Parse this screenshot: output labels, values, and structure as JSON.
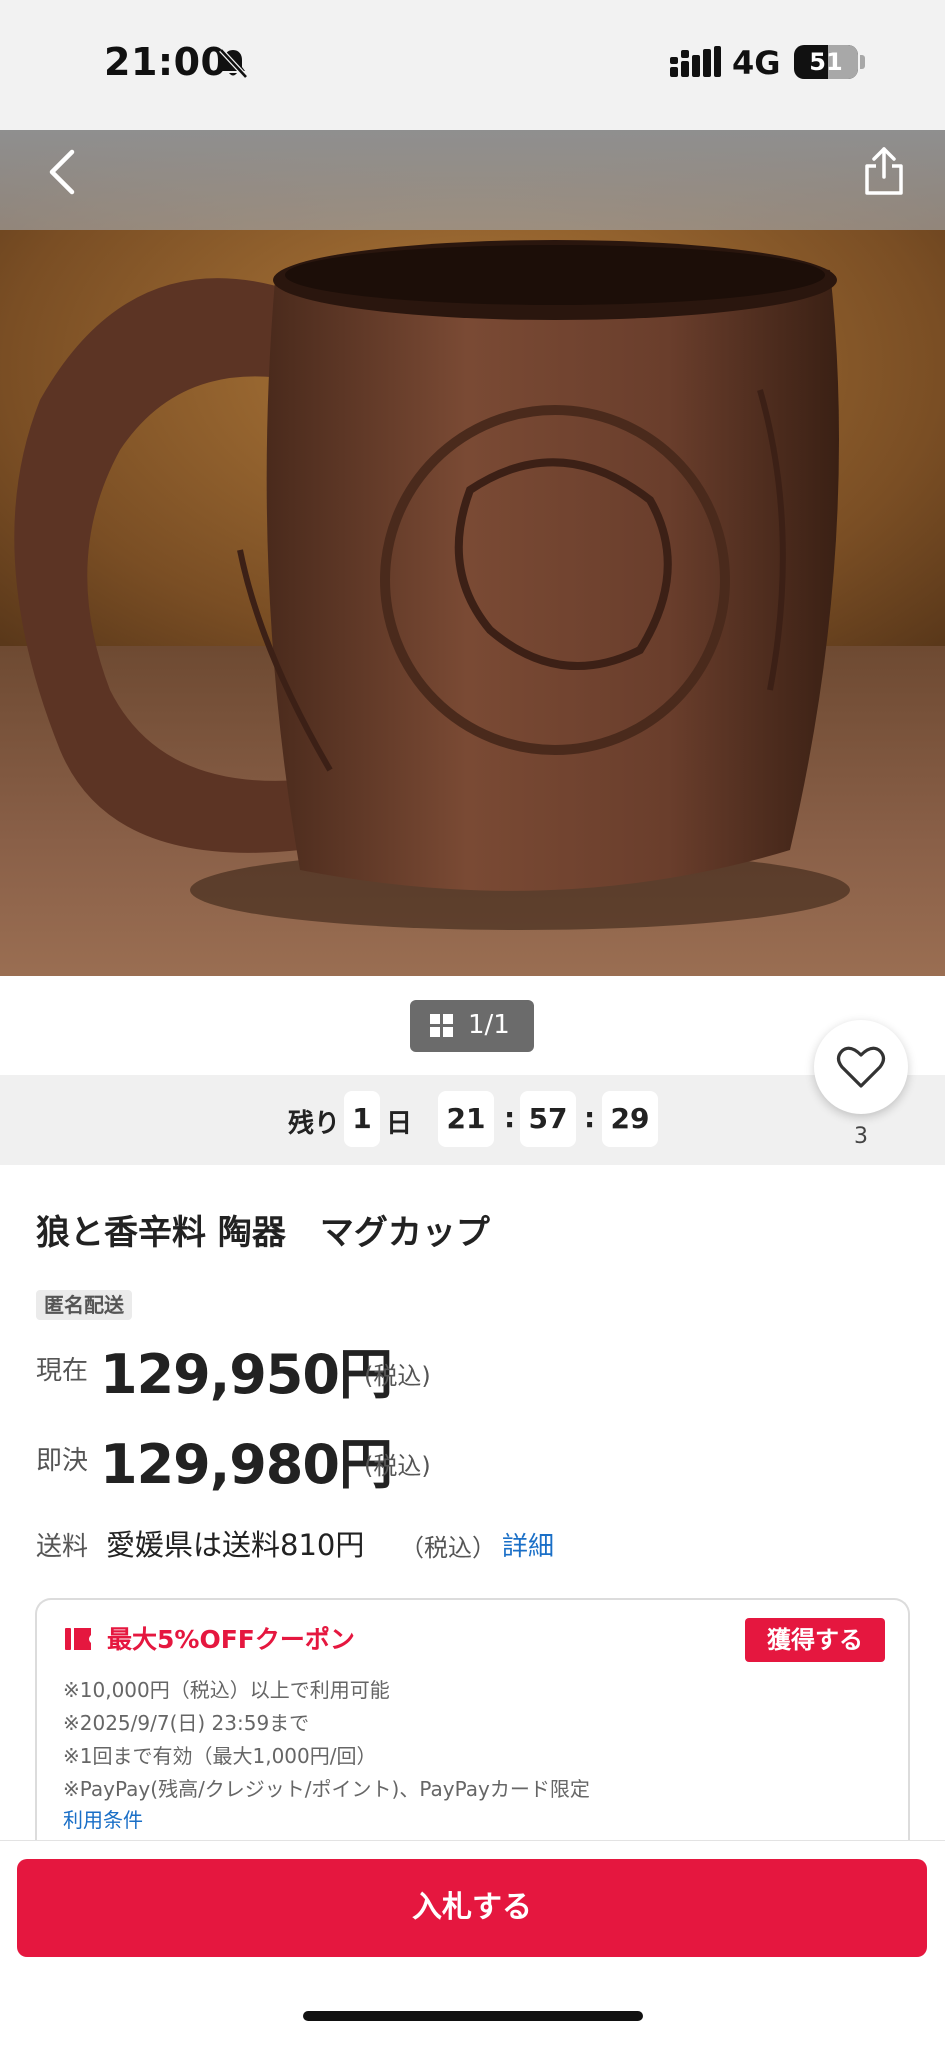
{
  "status_bar": {
    "time": "21:00",
    "network": "4G",
    "battery": "51"
  },
  "nav": {
    "back_icon": "chevron-left-icon",
    "share_icon": "share-icon"
  },
  "gallery": {
    "page_indicator": "1/1"
  },
  "countdown": {
    "remaining_label": "残り",
    "days": "1",
    "day_label": "日",
    "hours": "21",
    "minutes": "57",
    "seconds": "29",
    "separator": ":"
  },
  "watch": {
    "count": "3",
    "icon": "heart-icon"
  },
  "item": {
    "title": "狼と香辛料 陶器　マグカップ",
    "badge": "匿名配送",
    "current_label": "現在",
    "current_price": "129,950円",
    "current_tax": "(税込)",
    "buyout_label": "即決",
    "buyout_price": "129,980円",
    "buyout_tax": "(税込)",
    "shipping_label": "送料",
    "shipping_text": "愛媛県は送料810円",
    "shipping_tax": "（税込）",
    "shipping_detail": "詳細"
  },
  "coupon": {
    "title": "最大5%OFFクーポン",
    "get_button": "獲得する",
    "lines": [
      "※10,000円（税込）以上で利用可能",
      "※2025/9/7(日) 23:59まで",
      "※1回まで有効（最大1,000円/回）",
      "※PayPay(残高/クレジット/ポイント)、PayPayカード限定"
    ],
    "terms_link": "利用条件"
  },
  "actions": {
    "bid_button": "入札する"
  },
  "colors": {
    "accent": "#e5173f",
    "link": "#1a6fc7"
  }
}
